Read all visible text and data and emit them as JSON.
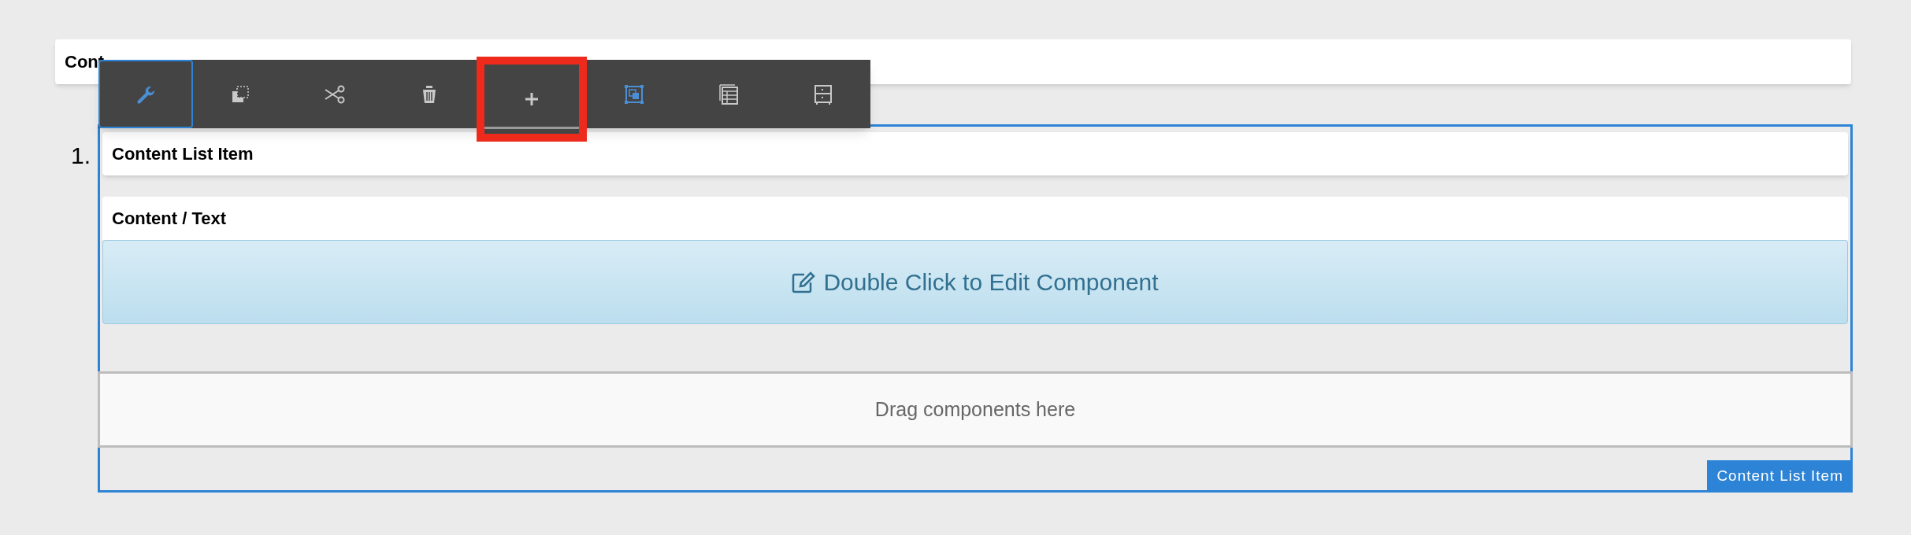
{
  "parent_bar": {
    "title": "Cont"
  },
  "toolbar": [
    {
      "kind": "wrench",
      "selected": true,
      "accent": true,
      "highlighted": false
    },
    {
      "kind": "copy",
      "selected": false,
      "accent": false,
      "highlighted": false
    },
    {
      "kind": "cut",
      "selected": false,
      "accent": false,
      "highlighted": false
    },
    {
      "kind": "trash",
      "selected": false,
      "accent": false,
      "highlighted": false
    },
    {
      "kind": "plus",
      "selected": false,
      "accent": false,
      "highlighted": true
    },
    {
      "kind": "group",
      "selected": false,
      "accent": true,
      "highlighted": false
    },
    {
      "kind": "table",
      "selected": false,
      "accent": false,
      "highlighted": false
    },
    {
      "kind": "cabinet",
      "selected": false,
      "accent": false,
      "highlighted": false
    }
  ],
  "list": {
    "marker": "1.",
    "item_bar": "Content List Item",
    "text_bar": "Content / Text",
    "edit_prompt": "Double Click to Edit Component",
    "drop_zone": "Drag components here",
    "tag": "Content List Item"
  }
}
